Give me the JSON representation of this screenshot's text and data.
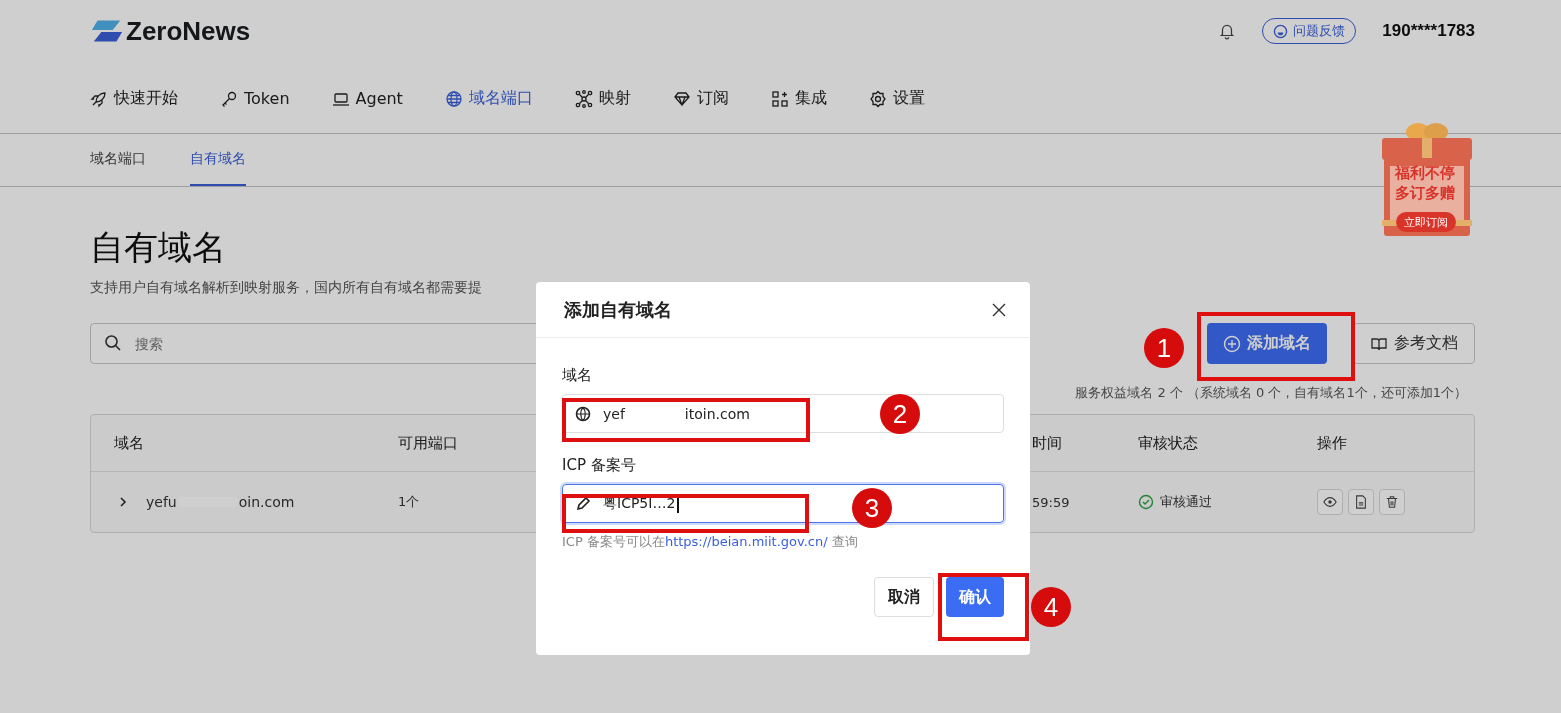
{
  "header": {
    "logo": "ZeroNews",
    "feedback": "问题反馈",
    "user": "190****1783"
  },
  "nav": [
    {
      "label": "快速开始",
      "selected": false
    },
    {
      "label": "Token",
      "selected": false
    },
    {
      "label": "Agent",
      "selected": false
    },
    {
      "label": "域名端口",
      "selected": true
    },
    {
      "label": "映射",
      "selected": false
    },
    {
      "label": "订阅",
      "selected": false
    },
    {
      "label": "集成",
      "selected": false
    },
    {
      "label": "设置",
      "selected": false
    }
  ],
  "subtabs": [
    {
      "label": "域名端口",
      "selected": false
    },
    {
      "label": "自有域名",
      "selected": true
    }
  ],
  "page": {
    "title": "自有域名",
    "description": "支持用户自有域名解析到映射服务，国内所有自有域名都需要提"
  },
  "search": {
    "placeholder": "搜索"
  },
  "actions": [
    {
      "label": "添加域名",
      "kind": "primary"
    },
    {
      "label": "参考文档",
      "kind": "default"
    }
  ],
  "quota": "服务权益域名 2 个 （系统域名 0 个，自有域名1个，还可添加1个）",
  "table": {
    "columns": [
      "域名",
      "可用端口",
      "时间",
      "审核状态",
      "操作"
    ],
    "rows": [
      {
        "expanded": false,
        "domain": [
          "yefu",
          "oin.com"
        ],
        "ports": "1个",
        "time": "59:59",
        "status": "审核通过"
      }
    ]
  },
  "promo": {
    "line1": "福利不停",
    "line2": "多订多赠",
    "button": "立即订阅"
  },
  "dialog": {
    "title": "添加自有域名",
    "fields": [
      {
        "label": "域名",
        "value": [
          "yef",
          "itoin.com"
        ],
        "focused": false
      },
      {
        "label": "ICP 备案号",
        "value": [
          "粤ICP5I…2"
        ],
        "focused": true
      }
    ],
    "help": {
      "text": "ICP 备案号可以在",
      "link": "https://beian.miit.gov.cn/",
      "after": " 查询"
    },
    "buttons": [
      {
        "label": "取消",
        "kind": "default"
      },
      {
        "label": "确认",
        "kind": "primary"
      }
    ]
  },
  "annotations": [
    {
      "label": "1"
    },
    {
      "label": "2"
    },
    {
      "label": "3"
    },
    {
      "label": "4"
    }
  ]
}
